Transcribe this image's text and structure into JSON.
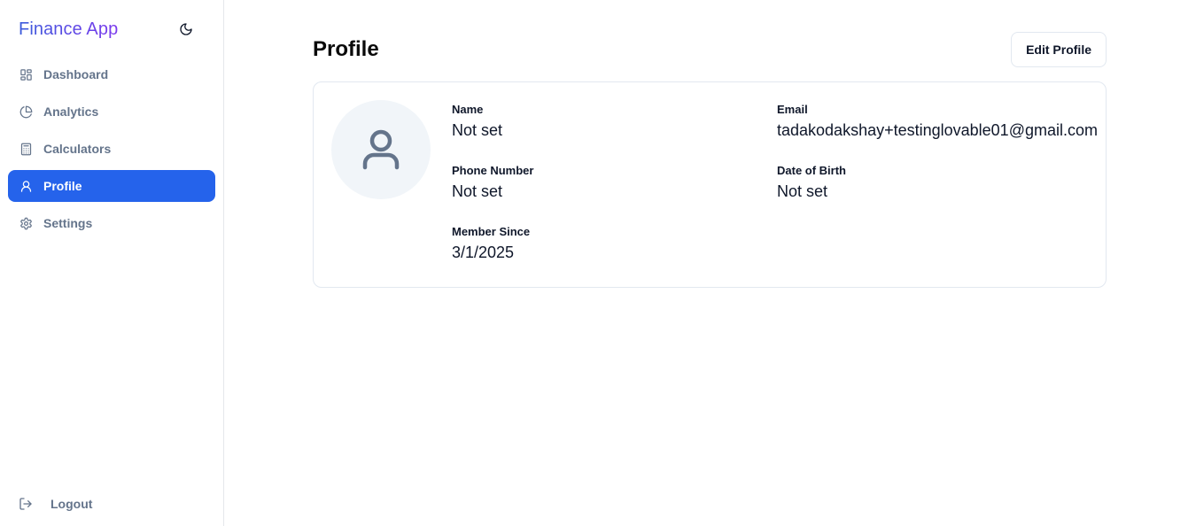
{
  "app": {
    "title": "Finance App"
  },
  "sidebar": {
    "items": [
      {
        "label": "Dashboard",
        "icon": "dashboard-grid-icon",
        "active": false
      },
      {
        "label": "Analytics",
        "icon": "pie-chart-icon",
        "active": false
      },
      {
        "label": "Calculators",
        "icon": "calculator-icon",
        "active": false
      },
      {
        "label": "Profile",
        "icon": "user-icon",
        "active": true
      },
      {
        "label": "Settings",
        "icon": "gear-icon",
        "active": false
      }
    ],
    "logout_label": "Logout",
    "theme_toggle_icon": "moon-icon"
  },
  "page": {
    "title": "Profile",
    "edit_button": "Edit Profile"
  },
  "profile": {
    "name_label": "Name",
    "name_value": "Not set",
    "email_label": "Email",
    "email_value": "tadakodakshay+testinglovable01@gmail.com",
    "phone_label": "Phone Number",
    "phone_value": "Not set",
    "dob_label": "Date of Birth",
    "dob_value": "Not set",
    "member_label": "Member Since",
    "member_value": "3/1/2025"
  },
  "colors": {
    "accent": "#2563eb",
    "brand_gradient_start": "#3b5bdb",
    "brand_gradient_end": "#7c3aed",
    "muted_text": "#64748b"
  }
}
